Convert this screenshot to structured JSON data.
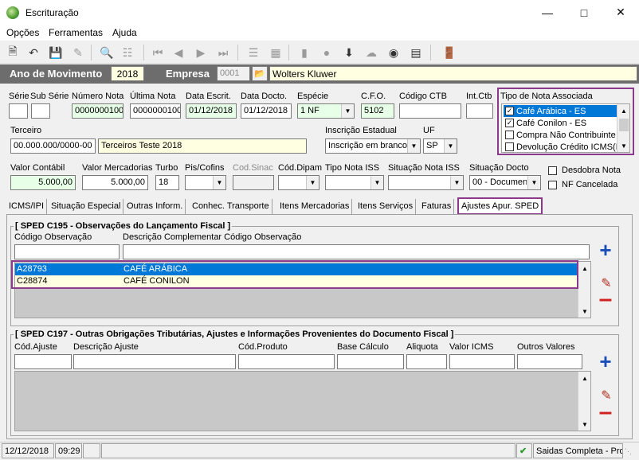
{
  "window": {
    "title": "Escrituração"
  },
  "menu": {
    "items": [
      "Opções",
      "Ferramentas",
      "Ajuda"
    ]
  },
  "band": {
    "ano_label": "Ano de Movimento",
    "ano_value": "2018",
    "empresa_label": "Empresa",
    "empresa_code": "0001",
    "empresa_name": "Wolters Kluwer"
  },
  "labels": {
    "serie": "Série",
    "sub_serie": "Sub Série",
    "numero_nota": "Número Nota",
    "ultima_nota": "Última Nota",
    "data_escrit": "Data Escrit.",
    "data_docto": "Data Docto.",
    "especie": "Espécie",
    "cfo": "C.F.O.",
    "codigo_ctb": "Código CTB",
    "int_ctb": "Int.Ctb",
    "terceiro": "Terceiro",
    "inscricao_estadual": "Inscrição Estadual",
    "uf": "UF",
    "valor_contabil": "Valor Contábil",
    "valor_mercadorias": "Valor Mercadorias",
    "turbo": "Turbo",
    "pis_cofins": "Pis/Cofins",
    "cod_sinac": "Cod.Sinac",
    "cod_dipam": "Cód.Dipam",
    "tipo_nota_iss": "Tipo Nota ISS",
    "situacao_nota_iss": "Situação Nota ISS",
    "situacao_docto": "Situação Docto",
    "desdobra_nota": "Desdobra Nota",
    "nf_cancelada": "NF Cancelada"
  },
  "values": {
    "numero_nota": "0000000100",
    "ultima_nota": "0000000100",
    "data_escrit": "01/12/2018",
    "data_docto": "01/12/2018",
    "especie": "1   NF",
    "cfo": "5102",
    "terceiro_code": "00.000.000/0000-00",
    "terceiro_name": "Terceiros Teste 2018",
    "inscricao_estadual": "Inscrição em branco",
    "uf": "SP",
    "valor_contabil": "5.000,00",
    "valor_mercadorias": "5.000,00",
    "turbo": "18",
    "situacao_docto": "00 - Documen"
  },
  "tipo_nota": {
    "title": "Tipo de Nota Associada",
    "items": [
      {
        "label": "Café Arábica - ES",
        "checked": "✓"
      },
      {
        "label": "Café Conilon - ES",
        "checked": "✓"
      },
      {
        "label": "Compra Não Contribuinte",
        "checked": ""
      },
      {
        "label": "Devolução Crédito ICMS(E",
        "checked": ""
      }
    ]
  },
  "tabs": [
    "ICMS/IPI",
    "Situação Especial",
    "Outras Inform.",
    "Conhec. Transporte",
    "Itens Mercadorias",
    "Itens Serviços",
    "Faturas",
    "Ajustes Apur. SPED"
  ],
  "c195": {
    "title": "[ SPED C195 - Observações do Lançamento Fiscal ]",
    "col_codigo": "Código Observação",
    "col_descricao": "Descrição Complementar Código Observação",
    "rows": [
      {
        "codigo": "A28793",
        "descricao": "CAFÉ ARÁBICA"
      },
      {
        "codigo": "C28874",
        "descricao": "CAFÉ CONILON"
      }
    ]
  },
  "c197": {
    "title": "[ SPED C197 - Outras Obrigações Tributárias, Ajustes e Informações Provenientes do Documento Fiscal  ]",
    "cols": [
      "Cód.Ajuste",
      "Descrição Ajuste",
      "Cód.Produto",
      "Base Cálculo",
      "Aliquota",
      "Valor ICMS",
      "Outros Valores"
    ]
  },
  "status": {
    "date": "12/12/2018",
    "time": "09:29",
    "message": "Saidas Completa - Pros"
  },
  "colors": {
    "accent": "#0078d7",
    "highlight": "#8b3a8b",
    "field_yellow": "#ffffe1",
    "band": "#6d6d6d"
  }
}
